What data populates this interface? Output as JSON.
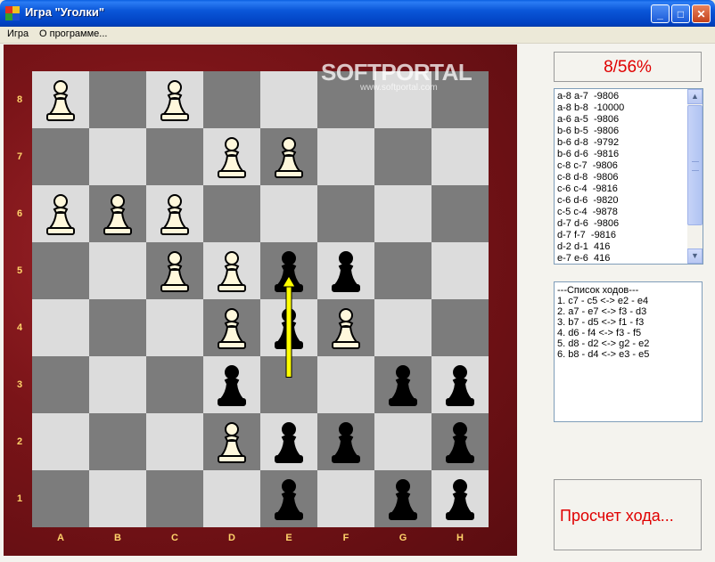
{
  "window": {
    "title": "Игра \"Уголки\"",
    "min_symbol": "_",
    "max_symbol": "□",
    "close_symbol": "✕"
  },
  "menu": {
    "items": [
      "Игра",
      "О программе..."
    ]
  },
  "board": {
    "files": [
      "A",
      "B",
      "C",
      "D",
      "E",
      "F",
      "G",
      "H"
    ],
    "ranks": [
      "8",
      "7",
      "6",
      "5",
      "4",
      "3",
      "2",
      "1"
    ],
    "light_color": "#dcdcdc",
    "dark_color": "#7c7c7c",
    "white_pieces": [
      "a8",
      "c8",
      "d7",
      "e7",
      "a6",
      "b6",
      "c6",
      "c5",
      "d5",
      "d4",
      "f4",
      "d2"
    ],
    "black_pieces": [
      "e5",
      "f5",
      "e4",
      "d3",
      "g3",
      "h3",
      "e2",
      "f2",
      "h2",
      "e1",
      "g1",
      "h1"
    ],
    "arrow": {
      "from": "e3",
      "to": "e5",
      "color": "#ffff00"
    }
  },
  "watermark": {
    "text": "SOFTPORTAL",
    "url": "www.softportal.com"
  },
  "progress": {
    "text": "8/56%"
  },
  "eval_list": [
    "a-8 a-7  -9806",
    "a-8 b-8  -10000",
    "a-6 a-5  -9806",
    "b-6 b-5  -9806",
    "b-6 d-8  -9792",
    "b-6 d-6  -9816",
    "c-8 c-7  -9806",
    "c-8 d-8  -9806",
    "c-6 c-4  -9816",
    "c-6 d-6  -9820",
    "c-5 c-4  -9878",
    "d-7 d-6  -9806",
    "d-7 f-7  -9816",
    "d-2 d-1  416",
    "e-7 e-6  416"
  ],
  "move_list": {
    "header": "---Список ходов---",
    "items": [
      "1. c7 - c5 <-> e2 - e4",
      "2. a7 - e7 <-> f3 - d3",
      "3. b7 - d5 <-> f1 - f3",
      "4. d6 - f4 <-> f3 - f5",
      "5. d8 - d2 <-> g2 - e2",
      "6. b8 - d4 <-> e3 - e5"
    ]
  },
  "status": {
    "text": "Просчет хода..."
  }
}
